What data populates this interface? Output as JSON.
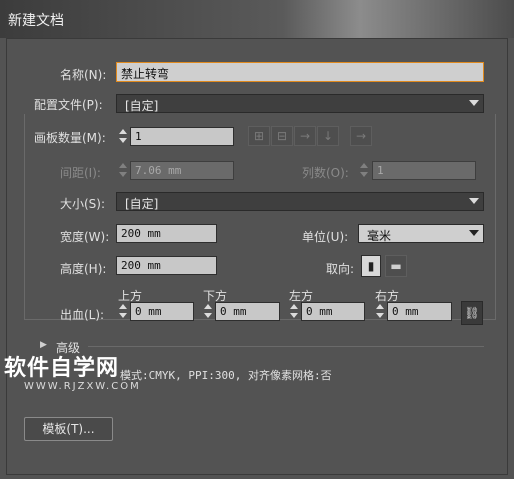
{
  "window": {
    "title": "新建文档"
  },
  "name": {
    "label": "名称(N):",
    "value": "禁止转弯"
  },
  "profile": {
    "label": "配置文件(P):",
    "value": "[自定]"
  },
  "artboards": {
    "count_label": "画板数量(M):",
    "count_value": "1",
    "spacing_label": "间距(I):",
    "spacing_value": "7.06 mm",
    "columns_label": "列数(O):",
    "columns_value": "1",
    "layout_icons": [
      "grid-by-row-icon",
      "grid-by-column-icon",
      "arrange-by-row-icon",
      "arrange-by-column-icon",
      "right-to-left-icon"
    ]
  },
  "size": {
    "label": "大小(S):",
    "value": "[自定]"
  },
  "width": {
    "label": "宽度(W):",
    "value": "200 mm"
  },
  "units": {
    "label": "单位(U):",
    "value": "毫米"
  },
  "height": {
    "label": "高度(H):",
    "value": "200 mm"
  },
  "orientation": {
    "label": "取向:"
  },
  "bleed": {
    "label": "出血(L):",
    "top_label": "上方",
    "top_value": "0 mm",
    "bottom_label": "下方",
    "bottom_value": "0 mm",
    "left_label": "左方",
    "left_value": "0 mm",
    "right_label": "右方",
    "right_value": "0 mm"
  },
  "advanced": {
    "label": "高级",
    "summary": "模式:CMYK, PPI:300, 对齐像素网格:否"
  },
  "watermark": {
    "text": "软件自学网",
    "url": "WWW.RJZXW.COM"
  },
  "buttons": {
    "templates": "模板(T)..."
  }
}
